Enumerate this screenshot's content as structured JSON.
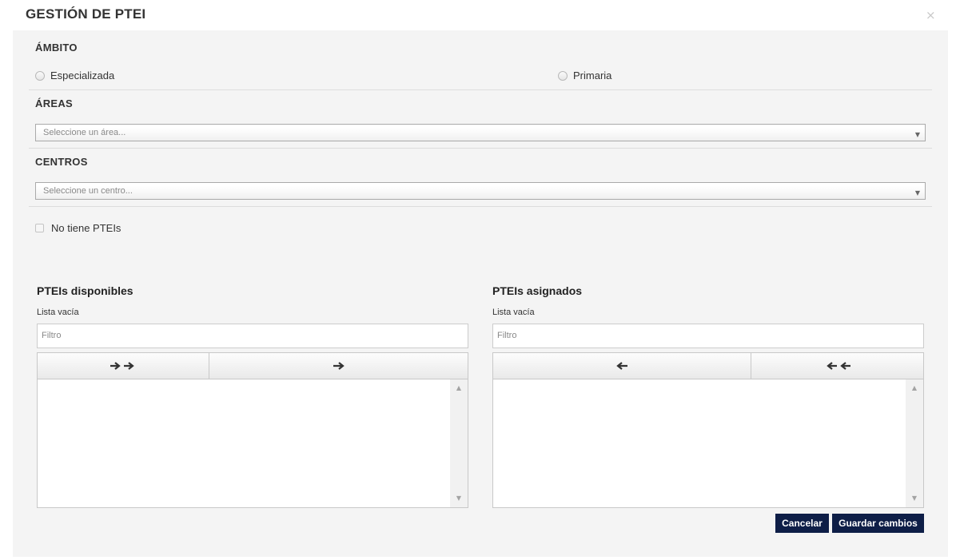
{
  "modal": {
    "title": "GESTIÓN DE PTEI",
    "close_label": "×"
  },
  "ambito": {
    "label": "ÁMBITO",
    "options": [
      {
        "label": "Especializada",
        "selected": false
      },
      {
        "label": "Primaria",
        "selected": false
      }
    ]
  },
  "areas": {
    "label": "ÁREAS",
    "placeholder": "Seleccione un área..."
  },
  "centros": {
    "label": "CENTROS",
    "placeholder": "Seleccione un centro..."
  },
  "no_ptei": {
    "label": "No tiene PTEIs",
    "checked": false
  },
  "available": {
    "title": "PTEIs disponibles",
    "info": "Lista vacía",
    "filter_placeholder": "Filtro",
    "items": []
  },
  "assigned": {
    "title": "PTEIs asignados",
    "info": "Lista vacía",
    "filter_placeholder": "Filtro",
    "items": []
  },
  "actions": {
    "cancel_label": "Cancelar",
    "save_label": "Guardar cambios"
  },
  "colors": {
    "primary_button": "#0e1e47",
    "panel_background": "#f4f4f4"
  }
}
